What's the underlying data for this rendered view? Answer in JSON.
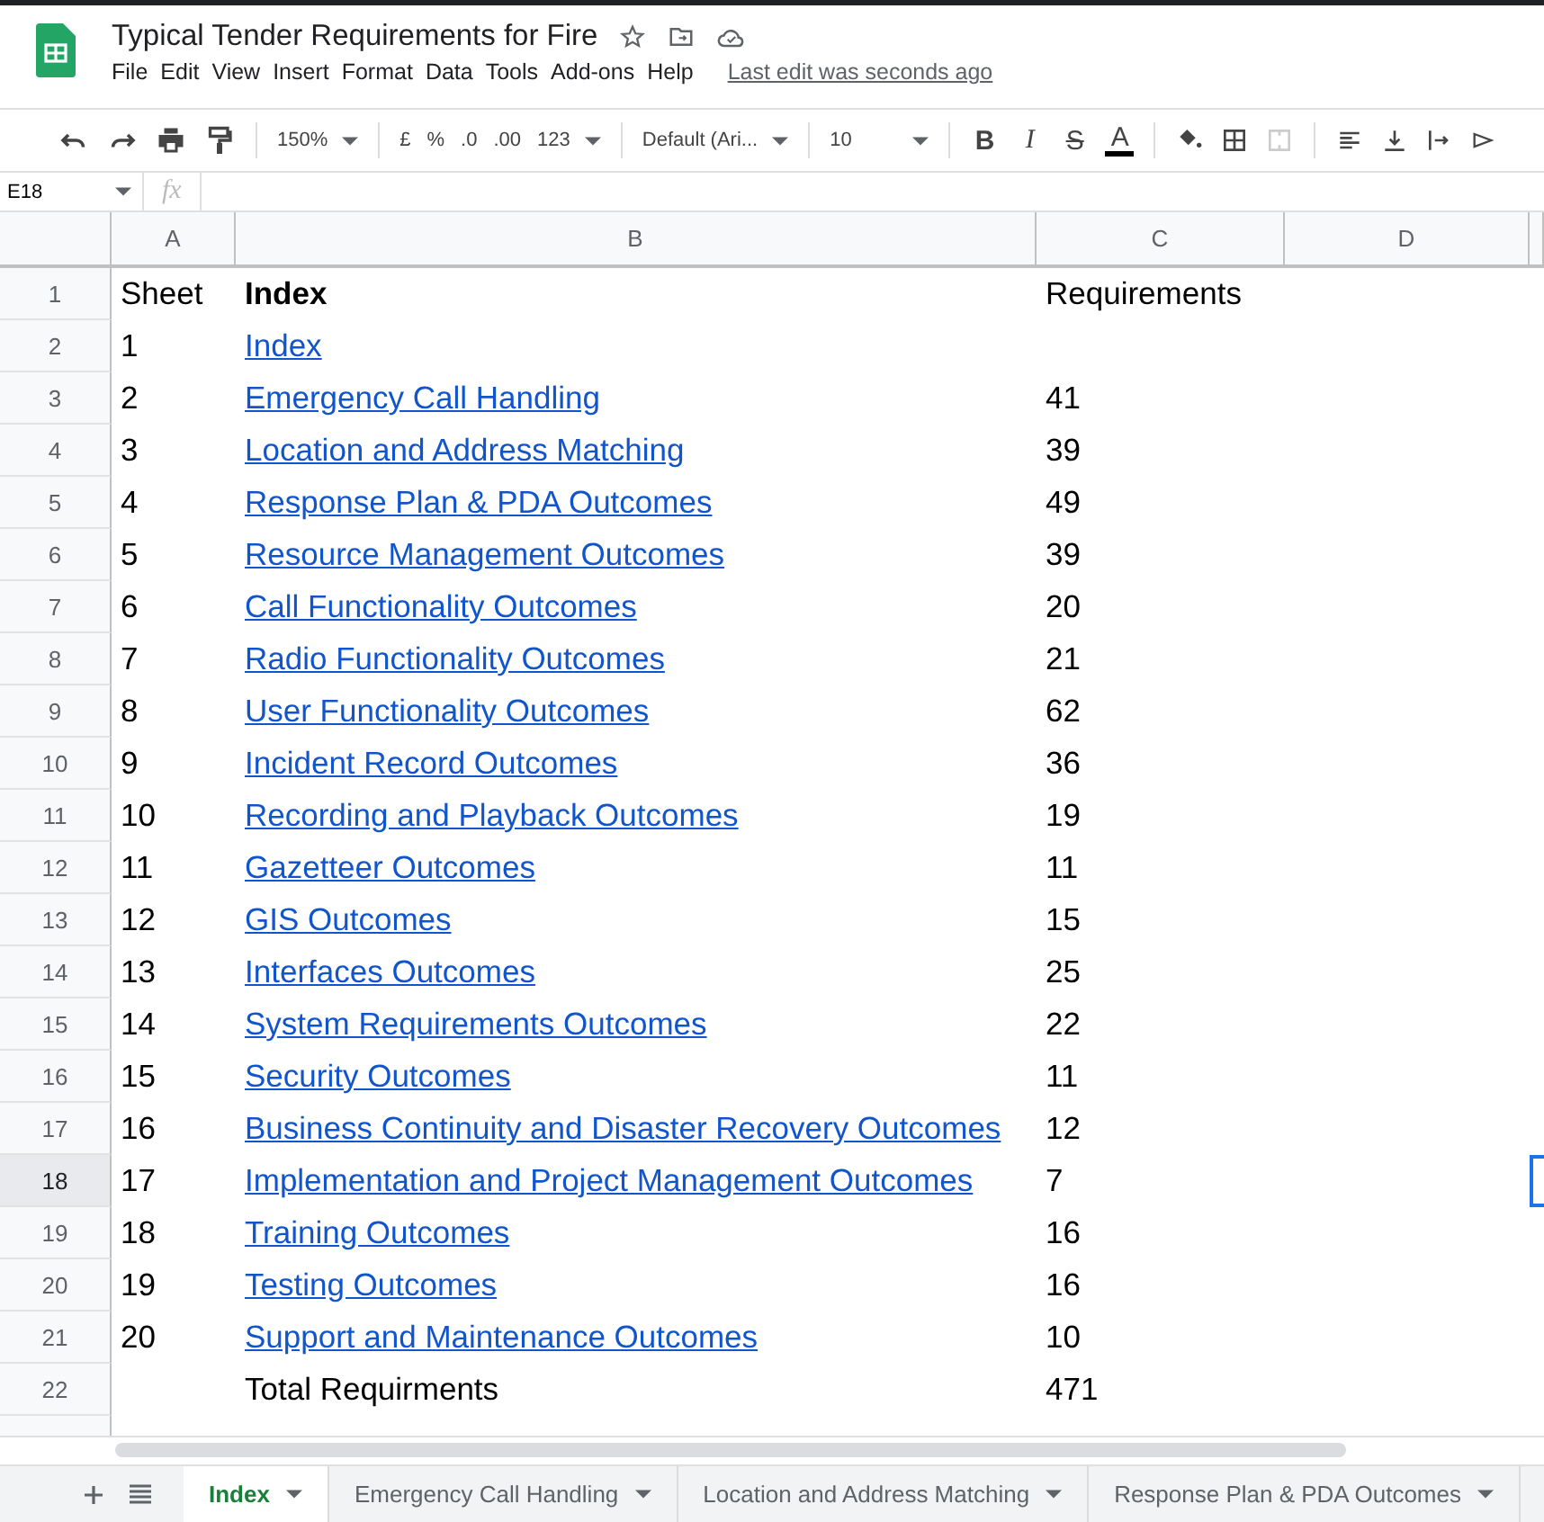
{
  "document": {
    "title": "Typical Tender Requirements for Fire",
    "last_edit": "Last edit was seconds ago"
  },
  "menu": [
    "File",
    "Edit",
    "View",
    "Insert",
    "Format",
    "Data",
    "Tools",
    "Add-ons",
    "Help"
  ],
  "toolbar": {
    "zoom": "150%",
    "currency": "£",
    "percent": "%",
    "decrease_decimals": ".0",
    "increase_decimals": ".00",
    "number_format": "123",
    "font": "Default (Ari...",
    "font_size": "10",
    "format_buttons": [
      {
        "kind": "bold",
        "label": "B"
      },
      {
        "kind": "italic",
        "label": "I"
      },
      {
        "kind": "strike",
        "label": "S"
      },
      {
        "kind": "color",
        "label": "A"
      }
    ]
  },
  "name_box": "E18",
  "function_label": "fx",
  "columns": [
    "A",
    "B",
    "C",
    "D"
  ],
  "rows": [
    {
      "number": "1",
      "selected": false,
      "a": "Sheet",
      "b": "Index",
      "bold": true,
      "link": false,
      "c": "Requirements"
    },
    {
      "number": "2",
      "selected": false,
      "a": "1",
      "b": "Index",
      "bold": false,
      "link": true
    },
    {
      "number": "3",
      "selected": false,
      "a": "2",
      "b": "Emergency Call Handling",
      "bold": false,
      "link": true,
      "c": "41"
    },
    {
      "number": "4",
      "selected": false,
      "a": "3",
      "b": "Location and Address Matching",
      "bold": false,
      "link": true,
      "c": "39"
    },
    {
      "number": "5",
      "selected": false,
      "a": "4",
      "b": "Response Plan & PDA Outcomes",
      "bold": false,
      "link": true,
      "c": "49"
    },
    {
      "number": "6",
      "selected": false,
      "a": "5",
      "b": "Resource Management Outcomes",
      "bold": false,
      "link": true,
      "c": "39"
    },
    {
      "number": "7",
      "selected": false,
      "a": "6",
      "b": "Call Functionality Outcomes",
      "bold": false,
      "link": true,
      "c": "20"
    },
    {
      "number": "8",
      "selected": false,
      "a": "7",
      "b": "Radio Functionality Outcomes",
      "bold": false,
      "link": true,
      "c": "21"
    },
    {
      "number": "9",
      "selected": false,
      "a": "8",
      "b": "User Functionality Outcomes",
      "bold": false,
      "link": true,
      "c": "62"
    },
    {
      "number": "10",
      "selected": false,
      "a": "9",
      "b": "Incident Record Outcomes",
      "bold": false,
      "link": true,
      "c": "36"
    },
    {
      "number": "11",
      "selected": false,
      "a": "10",
      "b": "Recording and Playback Outcomes",
      "bold": false,
      "link": true,
      "c": "19"
    },
    {
      "number": "12",
      "selected": false,
      "a": "11",
      "b": "Gazetteer Outcomes",
      "bold": false,
      "link": true,
      "c": "11"
    },
    {
      "number": "13",
      "selected": false,
      "a": "12",
      "b": "GIS Outcomes",
      "bold": false,
      "link": true,
      "c": "15"
    },
    {
      "number": "14",
      "selected": false,
      "a": "13",
      "b": "Interfaces Outcomes",
      "bold": false,
      "link": true,
      "c": "25"
    },
    {
      "number": "15",
      "selected": false,
      "a": "14",
      "b": "System Requirements Outcomes",
      "bold": false,
      "link": true,
      "c": "22"
    },
    {
      "number": "16",
      "selected": false,
      "a": "15",
      "b": "Security Outcomes",
      "bold": false,
      "link": true,
      "c": "11"
    },
    {
      "number": "17",
      "selected": false,
      "a": "16",
      "b": "Business Continuity and Disaster Recovery Outcomes",
      "bold": false,
      "link": true,
      "c": "12"
    },
    {
      "number": "18",
      "selected": true,
      "a": "17",
      "b": "Implementation and Project Management Outcomes",
      "bold": false,
      "link": true,
      "c": "7"
    },
    {
      "number": "19",
      "selected": false,
      "a": "18",
      "b": "Training Outcomes",
      "bold": false,
      "link": true,
      "c": "16"
    },
    {
      "number": "20",
      "selected": false,
      "a": "19",
      "b": "Testing Outcomes",
      "bold": false,
      "link": true,
      "c": "16"
    },
    {
      "number": "21",
      "selected": false,
      "a": "20",
      "b": "Support and Maintenance Outcomes",
      "bold": false,
      "link": true,
      "c": "10"
    },
    {
      "number": "22",
      "selected": false,
      "b": "Total Requirments",
      "bold": false,
      "link": false,
      "c": "471"
    }
  ],
  "sheet_tabs": [
    {
      "label": "Index",
      "selected": true
    },
    {
      "label": "Emergency Call Handling",
      "selected": false
    },
    {
      "label": "Location and Address Matching",
      "selected": false
    },
    {
      "label": "Response Plan & PDA Outcomes",
      "selected": false
    }
  ]
}
